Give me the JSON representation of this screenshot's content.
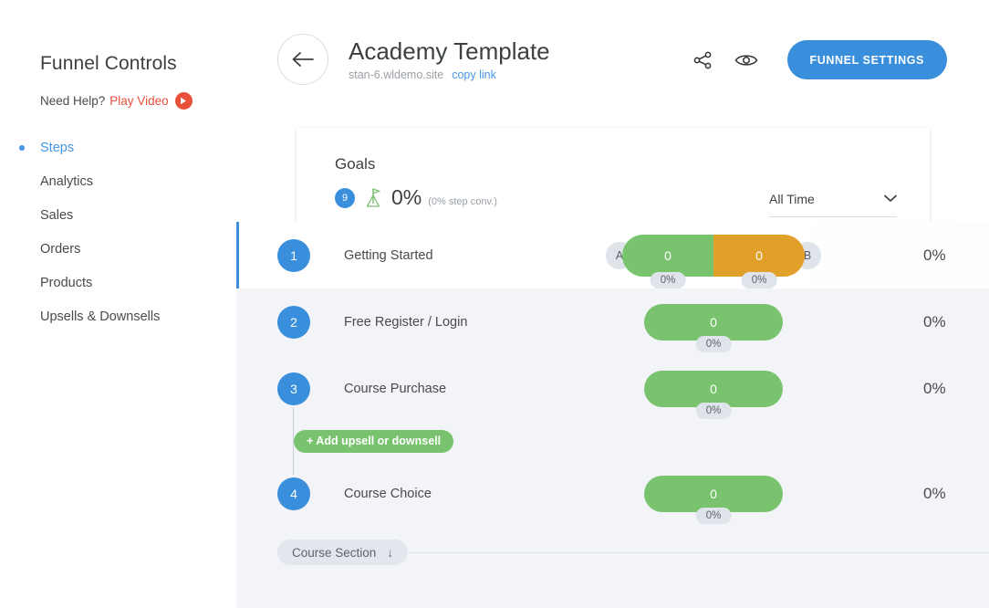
{
  "sidebar": {
    "title": "Funnel Controls",
    "help": {
      "prefix": "Need Help?",
      "link": "Play Video",
      "icon": "play-circle-icon"
    },
    "items": [
      {
        "label": "Steps",
        "active": true
      },
      {
        "label": "Analytics",
        "active": false
      },
      {
        "label": "Sales",
        "active": false
      },
      {
        "label": "Orders",
        "active": false
      },
      {
        "label": "Products",
        "active": false
      },
      {
        "label": "Upsells & Downsells",
        "active": false
      }
    ]
  },
  "header": {
    "back_icon": "arrow-left-icon",
    "title": "Academy Template",
    "domain": "stan-6.wldemo.site",
    "copy_link": "copy link",
    "share_icon": "share-icon",
    "preview_icon": "eye-icon",
    "settings_label": "FUNNEL SETTINGS"
  },
  "goals": {
    "label": "Goals",
    "badge_count": "9",
    "flag_icon": "goal-flag-icon",
    "percent": "0%",
    "conversion_note": "(0% step conv.)",
    "range_value": "All Time",
    "range_icon": "chevron-down-icon"
  },
  "steps": [
    {
      "number": "1",
      "name": "Getting Started",
      "selected": true,
      "split_test": true,
      "variants": [
        {
          "cap": "A",
          "count": "0",
          "percent": "0%",
          "color": "#79c36e"
        },
        {
          "cap": "B",
          "count": "0",
          "percent": "0%",
          "color": "#e0a02a"
        }
      ],
      "percent": "0%"
    },
    {
      "number": "2",
      "name": "Free Register / Login",
      "selected": false,
      "split_test": false,
      "count": "0",
      "bar_percent": "0%",
      "percent": "0%"
    },
    {
      "number": "3",
      "name": "Course Purchase",
      "selected": false,
      "split_test": false,
      "count": "0",
      "bar_percent": "0%",
      "percent": "0%"
    },
    {
      "number": "4",
      "name": "Course Choice",
      "selected": false,
      "split_test": false,
      "count": "0",
      "bar_percent": "0%",
      "percent": "0%"
    }
  ],
  "upsell": {
    "label": "+ Add upsell or downsell"
  },
  "section": {
    "label": "Course Section",
    "icon": "arrow-down-icon",
    "arrow": "↓"
  },
  "colors": {
    "accent_blue": "#3a8fdc",
    "link_blue": "#4596e6",
    "green": "#79c36e",
    "orange": "#e0a02a",
    "red": "#e8503a",
    "page_bg": "#f2f4f8"
  }
}
